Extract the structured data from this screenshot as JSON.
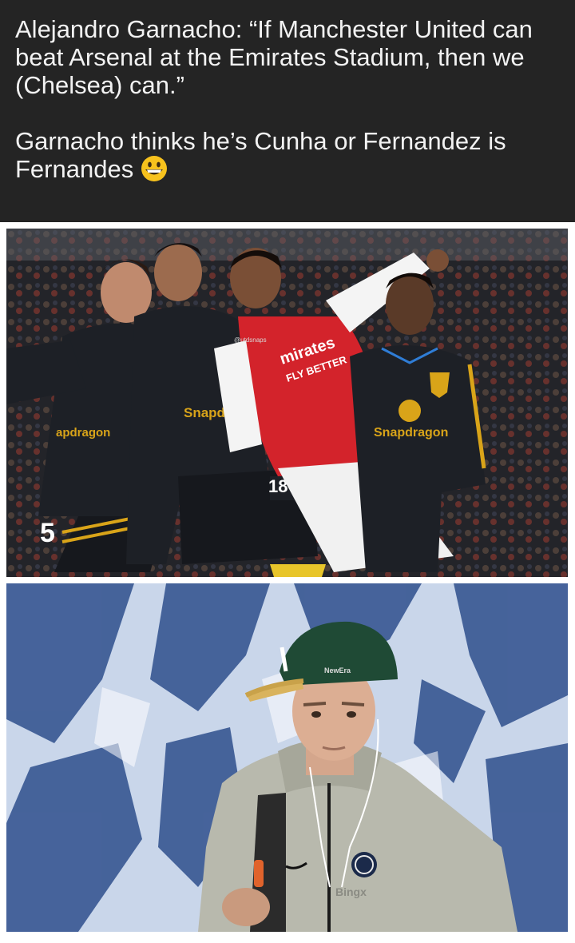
{
  "post": {
    "paragraph_1": "Alejandro Garnacho: “If Manchester United can beat Arsenal at the Emirates Stadium, then we (Chelsea) can.”",
    "paragraph_2": "Garnacho thinks he’s Cunha or Fernandez is Fernandes",
    "emoji_icon": "grinning-face-emoji"
  },
  "photo_top": {
    "sponsor_text": "Snapdragon",
    "sponsor_text_partial_left": "apdragon",
    "sponsor_text_partial_mid": "Snapd",
    "arsenal_sponsor_line1": "mirates",
    "arsenal_sponsor_line2": "FLY BETTER",
    "shirt_number_left": "5",
    "shirt_number_mid": "18",
    "watermark": "@utdsnaps",
    "colors": {
      "united_kit": "#1d2026",
      "trim": "#d9a419",
      "arsenal_red": "#d3232b"
    }
  },
  "photo_bottom": {
    "hoodie_sponsor": "Bingx",
    "cap_brand": "NewEra",
    "colors": {
      "backdrop": "#3a5c9c",
      "cap": "#1f4a35",
      "hoodie": "#b8b9ad"
    }
  }
}
